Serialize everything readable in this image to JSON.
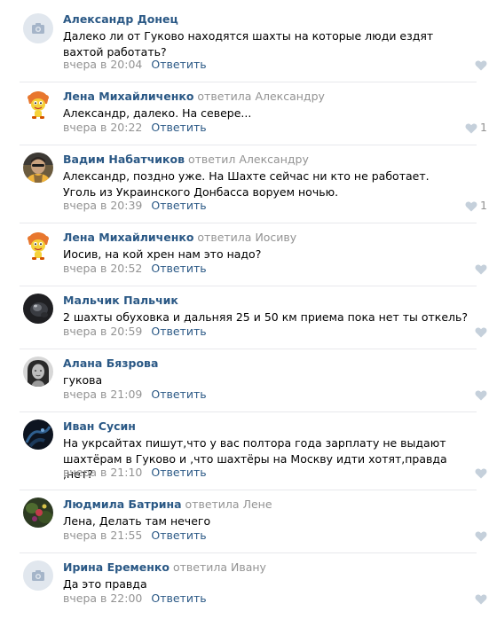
{
  "comments": [
    {
      "author": "Александр Донец",
      "reply_verb": "",
      "reply_to": "",
      "text": "Далеко ли от Гуково находятся шахты на которые люди ездят вахтой работать?",
      "date": "вчера в 20:04",
      "reply_label": "Ответить",
      "likes": "",
      "avatar": "camera-placeholder"
    },
    {
      "author": "Лена Михайличенко",
      "reply_verb": "ответила",
      "reply_to": "Александру",
      "text": "Александр, далеко. На севере...",
      "date": "вчера в 20:22",
      "reply_label": "Ответить",
      "likes": "1",
      "avatar": "cartoon-character"
    },
    {
      "author": "Вадим Набатчиков",
      "reply_verb": "ответил",
      "reply_to": "Александру",
      "text": "Александр, поздно уже. На Шахте сейчас ни кто не работает. Уголь из Украинского Донбасса воруем ночью.",
      "date": "вчера в 20:39",
      "reply_label": "Ответить",
      "likes": "1",
      "avatar": "man-photo"
    },
    {
      "author": "Лена Михайличенко",
      "reply_verb": "ответила",
      "reply_to": "Иосиву",
      "text": "Иосив, на кой хрен нам это надо?",
      "date": "вчера в 20:52",
      "reply_label": "Ответить",
      "likes": "",
      "avatar": "cartoon-character"
    },
    {
      "author": "Мальчик Пальчик",
      "reply_verb": "",
      "reply_to": "",
      "text": "2 шахты обуховка и дальняя 25 и 50 км приема пока нет ты откель?",
      "date": "вчера в 20:59",
      "reply_label": "Ответить",
      "likes": "",
      "avatar": "dark-photo"
    },
    {
      "author": "Алана Бязрова",
      "reply_verb": "",
      "reply_to": "",
      "text": "гукова",
      "date": "вчера в 21:09",
      "reply_label": "Ответить",
      "likes": "",
      "avatar": "woman-bw-photo"
    },
    {
      "author": "Иван Сусин",
      "reply_verb": "",
      "reply_to": "",
      "text": "На укрсайтах пишут,что у вас полтора года зарплату не выдают шахтёрам в Гуково и ,что шахтёры на Москву идти хотят,правда ,нет?",
      "date": "вчера в 21:10",
      "reply_label": "Ответить",
      "likes": "",
      "avatar": "night-photo"
    },
    {
      "author": "Людмила Батрина",
      "reply_verb": "ответила",
      "reply_to": "Лене",
      "text": "Лена, Делать там нечего",
      "date": "вчера в 21:55",
      "reply_label": "Ответить",
      "likes": "",
      "avatar": "nature-photo"
    },
    {
      "author": "Ирина Еременко",
      "reply_verb": "ответила",
      "reply_to": "Ивану",
      "text": "Да это правда",
      "date": "вчера в 22:00",
      "reply_label": "Ответить",
      "likes": "",
      "avatar": "camera-placeholder"
    }
  ],
  "colors": {
    "link": "#2a5885",
    "muted": "#939393",
    "divider": "#e7e8ec",
    "like_icon": "#c5d0db",
    "placeholder_bg": "#e1e7ee",
    "placeholder_icon": "#a5b5c9"
  }
}
